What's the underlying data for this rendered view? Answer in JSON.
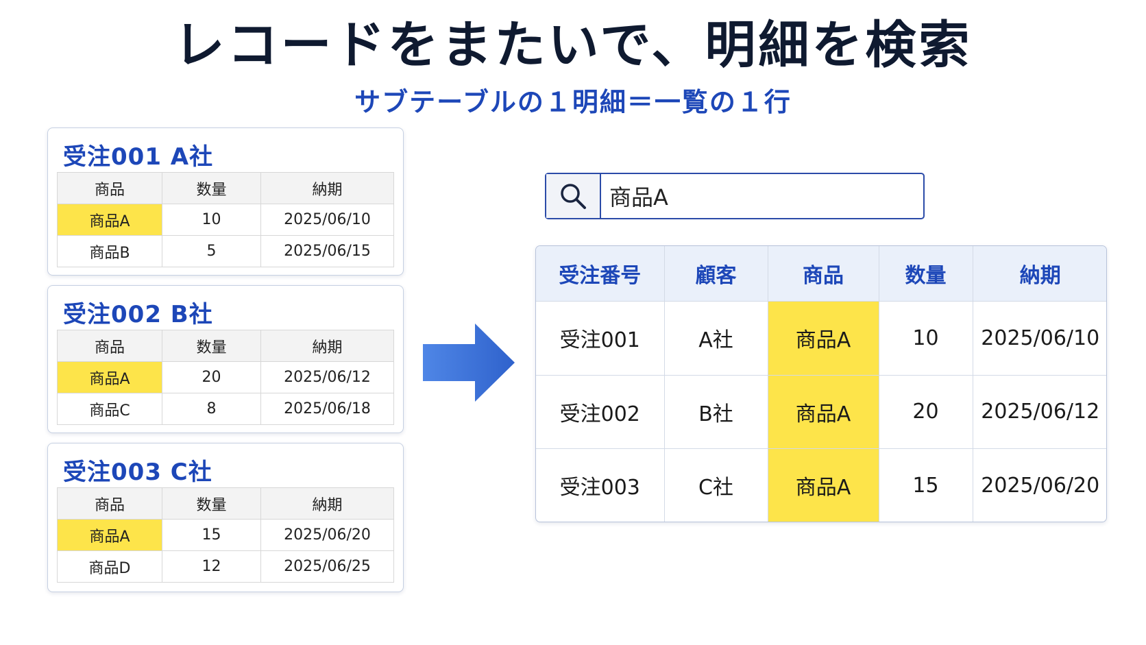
{
  "title": "レコードをまたいで、明細を検索",
  "subtitle": "サブテーブルの１明細＝一覧の１行",
  "colors": {
    "accent": "#1d47b8",
    "highlight": "#fde44a",
    "arrow": "#3a74d8"
  },
  "records": [
    {
      "title": "受注001 A社",
      "headers": [
        "商品",
        "数量",
        "納期"
      ],
      "rows": [
        {
          "product": "商品A",
          "qty": "10",
          "due": "2025/06/10",
          "highlight": true
        },
        {
          "product": "商品B",
          "qty": "5",
          "due": "2025/06/15",
          "highlight": false
        }
      ]
    },
    {
      "title": "受注002 B社",
      "headers": [
        "商品",
        "数量",
        "納期"
      ],
      "rows": [
        {
          "product": "商品A",
          "qty": "20",
          "due": "2025/06/12",
          "highlight": true
        },
        {
          "product": "商品C",
          "qty": "8",
          "due": "2025/06/18",
          "highlight": false
        }
      ]
    },
    {
      "title": "受注003 C社",
      "headers": [
        "商品",
        "数量",
        "納期"
      ],
      "rows": [
        {
          "product": "商品A",
          "qty": "15",
          "due": "2025/06/20",
          "highlight": true
        },
        {
          "product": "商品D",
          "qty": "12",
          "due": "2025/06/25",
          "highlight": false
        }
      ]
    }
  ],
  "search": {
    "icon": "search-icon",
    "value": "商品A"
  },
  "result": {
    "headers": [
      "受注番号",
      "顧客",
      "商品",
      "数量",
      "納期"
    ],
    "rows": [
      [
        "受注001",
        "A社",
        "商品A",
        "10",
        "2025/06/10"
      ],
      [
        "受注002",
        "B社",
        "商品A",
        "20",
        "2025/06/12"
      ],
      [
        "受注003",
        "C社",
        "商品A",
        "15",
        "2025/06/20"
      ]
    ]
  }
}
